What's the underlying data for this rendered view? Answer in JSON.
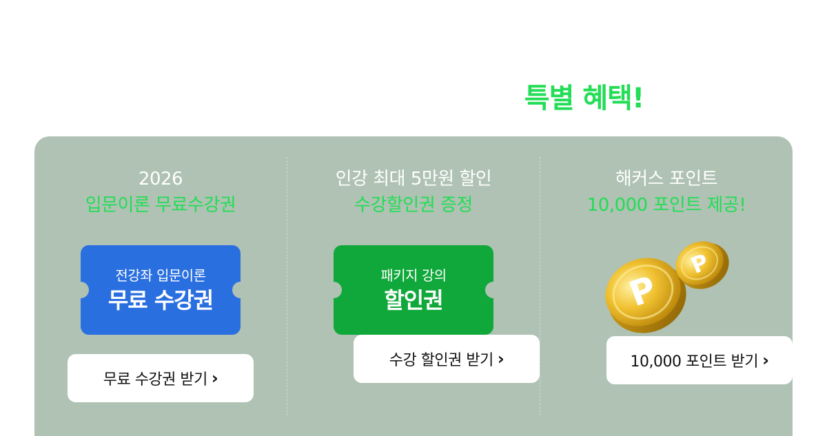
{
  "header": {
    "title_accent": "특별 혜택!"
  },
  "benefits": [
    {
      "line1": "2026",
      "line2": "입문이론 무료수강권",
      "ticket_small": "전강좌 입문이론",
      "ticket_big": "무료 수강권",
      "button": "무료 수강권 받기",
      "color": "#2a6fe0"
    },
    {
      "line1": "인강 최대 5만원 할인",
      "line2": "수강할인권 증정",
      "ticket_small": "패키지 강의",
      "ticket_big": "할인권",
      "button": "수강 할인권 받기",
      "color": "#10a83a"
    },
    {
      "line1": "해커스 포인트",
      "line2": "10,000 포인트 제공!",
      "coin_letter": "P",
      "button": "10,000 포인트 받기",
      "icon": "gold-coins-icon"
    }
  ],
  "chevron": "›",
  "colors": {
    "accent_green": "#22dd55",
    "panel_bg": "#afc2b3"
  }
}
